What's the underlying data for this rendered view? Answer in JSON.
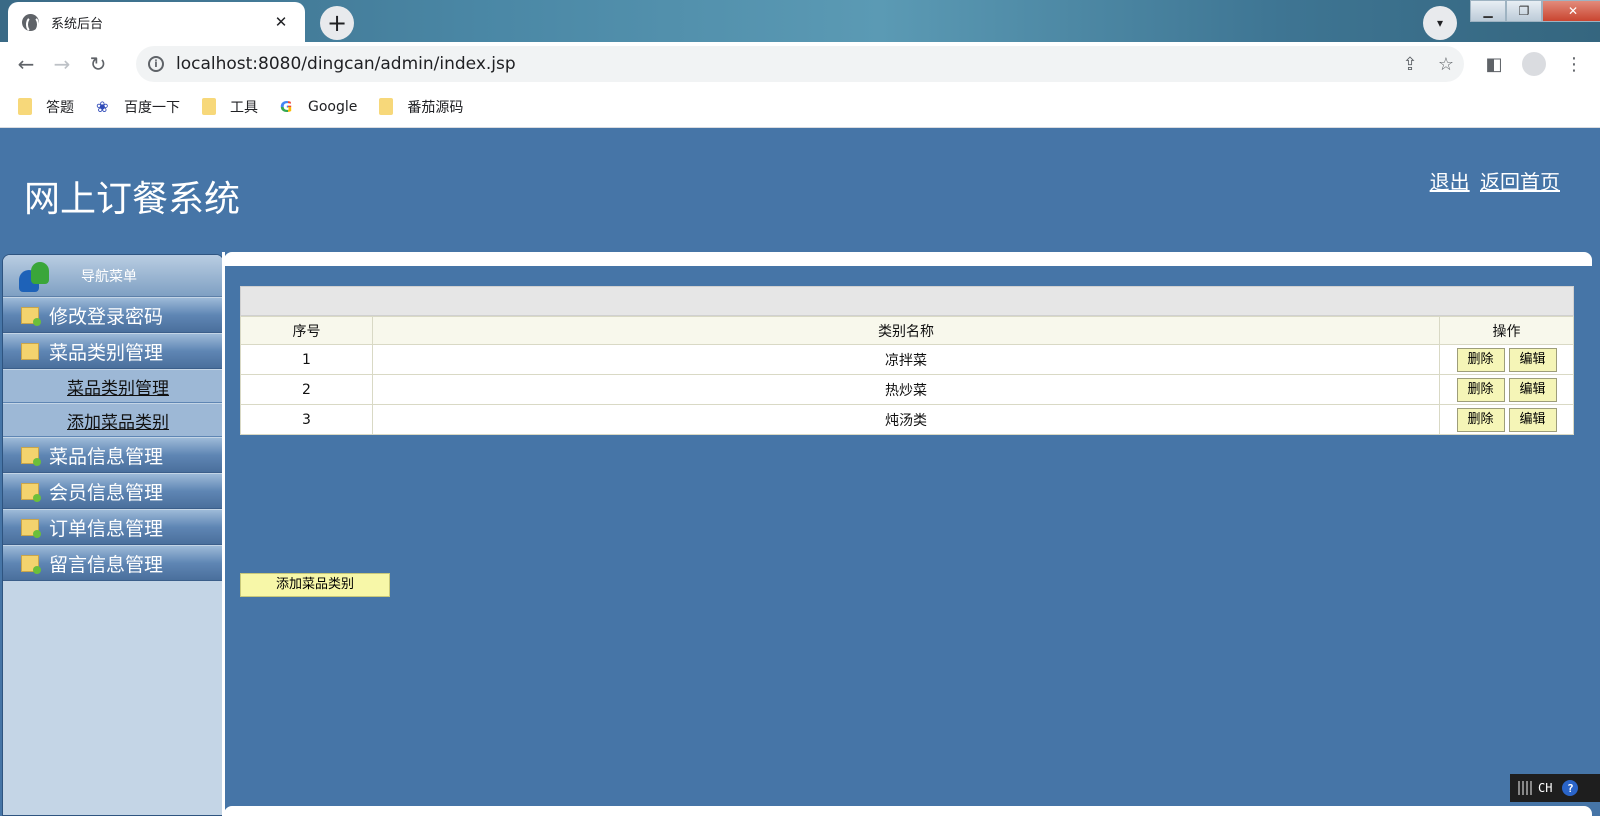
{
  "browser": {
    "tab_title": "系统后台",
    "tab_close": "✕",
    "new_tab": "+",
    "url": "localhost:8080/dingcan/admin/index.jsp",
    "bookmarks": [
      {
        "label": "答题",
        "icon": "folder-icon"
      },
      {
        "label": "百度一下",
        "icon": "baidu-icon"
      },
      {
        "label": "工具",
        "icon": "folder-icon"
      },
      {
        "label": "Google",
        "icon": "google-icon"
      },
      {
        "label": "番茄源码",
        "icon": "folder-icon"
      }
    ]
  },
  "header": {
    "title": "网上订餐系统",
    "logout": "退出",
    "home": "返回首页"
  },
  "sidebar": {
    "heading": "导航菜单",
    "items": [
      {
        "label": "修改登录密码"
      },
      {
        "label": "菜品类别管理",
        "subitems": [
          "菜品类别管理",
          "添加菜品类别"
        ]
      },
      {
        "label": "菜品信息管理"
      },
      {
        "label": "会员信息管理"
      },
      {
        "label": "订单信息管理"
      },
      {
        "label": "留言信息管理"
      }
    ]
  },
  "table": {
    "columns": [
      "序号",
      "类别名称",
      "操作"
    ],
    "rows": [
      {
        "no": "1",
        "name": "凉拌菜"
      },
      {
        "no": "2",
        "name": "热炒菜"
      },
      {
        "no": "3",
        "name": "炖汤类"
      }
    ],
    "delete_label": "删除",
    "edit_label": "编辑",
    "add_button": "添加菜品类别"
  },
  "ime": {
    "lang": "CH",
    "help": "?"
  },
  "colors": {
    "page_bg": "#4675a7",
    "button_bg": "#f5f5b7",
    "header_row": "#f8f8ec"
  }
}
